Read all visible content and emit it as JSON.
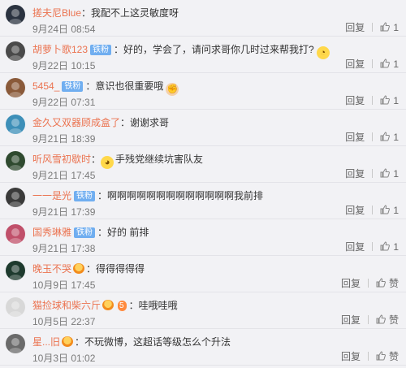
{
  "comments": [
    {
      "user": "搓夫尼Blue",
      "badge": "",
      "medal": false,
      "text": "我配不上这灵敏度呀",
      "emoji": "",
      "time": "9月24日 08:54",
      "reply": "回复",
      "like": "1",
      "avatar_color": "#2b3340"
    },
    {
      "user": "胡萝卜歌123",
      "badge": "铁粉",
      "medal": false,
      "text": "好的，学会了，请问求哥你几时过来帮我打?",
      "emoji": "face",
      "time": "9月22日 10:15",
      "reply": "回复",
      "like": "1",
      "avatar_color": "#4a4a4a"
    },
    {
      "user": "5454_",
      "badge": "铁粉",
      "medal": false,
      "text": "意识也很重要哦",
      "emoji": "fist",
      "time": "9月22日 07:31",
      "reply": "回复",
      "like": "1",
      "avatar_color": "#8a5a3a"
    },
    {
      "user": "金久又双器顾成盒了",
      "badge": "",
      "medal": false,
      "text": "谢谢求哥",
      "emoji": "",
      "time": "9月21日 18:39",
      "reply": "回复",
      "like": "1",
      "avatar_color": "#3d8fb8"
    },
    {
      "user": "听风雪初歇时",
      "badge": "",
      "medal": false,
      "text": "手残党继续坑害队友",
      "emoji": "face",
      "time": "9月21日 17:45",
      "reply": "回复",
      "like": "1",
      "avatar_color": "#2f4a2f",
      "emoji_before": true
    },
    {
      "user": "一一是光",
      "badge": "铁粉",
      "medal": false,
      "text": "啊啊啊啊啊啊啊啊啊啊啊啊啊我前排",
      "emoji": "",
      "time": "9月21日 17:39",
      "reply": "回复",
      "like": "1",
      "avatar_color": "#3a3a3a"
    },
    {
      "user": "国秀琳雅",
      "badge": "铁粉",
      "medal": false,
      "text": "好的 前排",
      "emoji": "",
      "time": "9月21日 17:38",
      "reply": "回复",
      "like": "1",
      "avatar_color": "#c0506a"
    },
    {
      "user": "晚玉不哭",
      "badge": "",
      "medal": true,
      "text": "得得得得得",
      "emoji": "",
      "time": "10月9日 17:45",
      "reply": "回复",
      "like": "赞",
      "avatar_color": "#1e3a2e"
    },
    {
      "user": "猫捡球和柴六斤",
      "badge": "",
      "medal": true,
      "text": "哇哦哇哦",
      "emoji": "",
      "time": "10月5日 22:37",
      "reply": "回复",
      "like": "赞",
      "avatar_color": "#d8d8d8"
    },
    {
      "user": "星...旧",
      "badge": "",
      "medal": true,
      "text": "不玩微博，这超话等级怎么个升法",
      "emoji": "",
      "time": "10月3日 01:02",
      "reply": "回复",
      "like": "赞",
      "avatar_color": "#6a6a6a"
    }
  ],
  "badge_labels": {
    "vip": "5"
  },
  "colors": {
    "name": "#eb7350",
    "badge": "#70aef0",
    "background": "#f2f2f5"
  }
}
